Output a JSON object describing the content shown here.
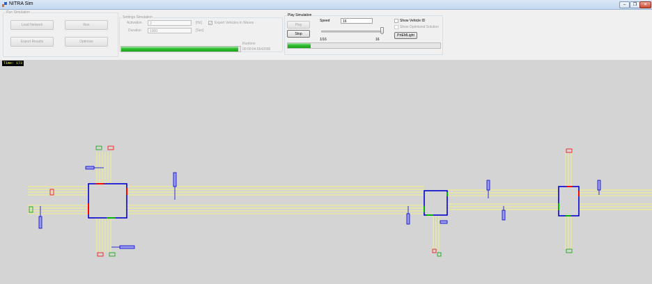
{
  "window": {
    "title": "NITRA Sim",
    "controls": [
      "–",
      "❐",
      "✕"
    ]
  },
  "run_simulation": {
    "group_label": "Run Simulation",
    "load_network": "Load Network",
    "run": "Run",
    "export_results": "Export Results",
    "optimize": "Optimize"
  },
  "settings": {
    "group_label": "Settings Simulation",
    "activation_label": "Activation",
    "activation_value": "2",
    "activation_unit": "[Hz]",
    "export_vehicles_label": "Export Vehicles in Waves",
    "duration_label": "Duration",
    "duration_value": "1000",
    "duration_unit": "[Sec]",
    "runtime_label": "Runtime",
    "runtime_value": "00:00:04.6542000",
    "progress_fraction": 0.98
  },
  "play": {
    "group_label": "Play Simulation",
    "play_button": "Play",
    "stop_button": "Stop",
    "speed_label": "Speed",
    "speed_value": "16",
    "slider_min_label": "1/16",
    "slider_max_label": "16",
    "slider_fraction": 1.0,
    "show_vehicle_id": "Show Vehicle ID",
    "show_optimized": "Show Optimized Solution",
    "print_button": "PrtEMLight",
    "progress_fraction": 0.15
  },
  "canvas": {
    "time_label": "Time: 173"
  },
  "colors": {
    "road": "#ffff66",
    "intersection": "#0000cc",
    "signal_red": "#ff0000",
    "signal_green": "#00b000",
    "background": "#d4d4d4",
    "progress": "#2fbb2f"
  }
}
